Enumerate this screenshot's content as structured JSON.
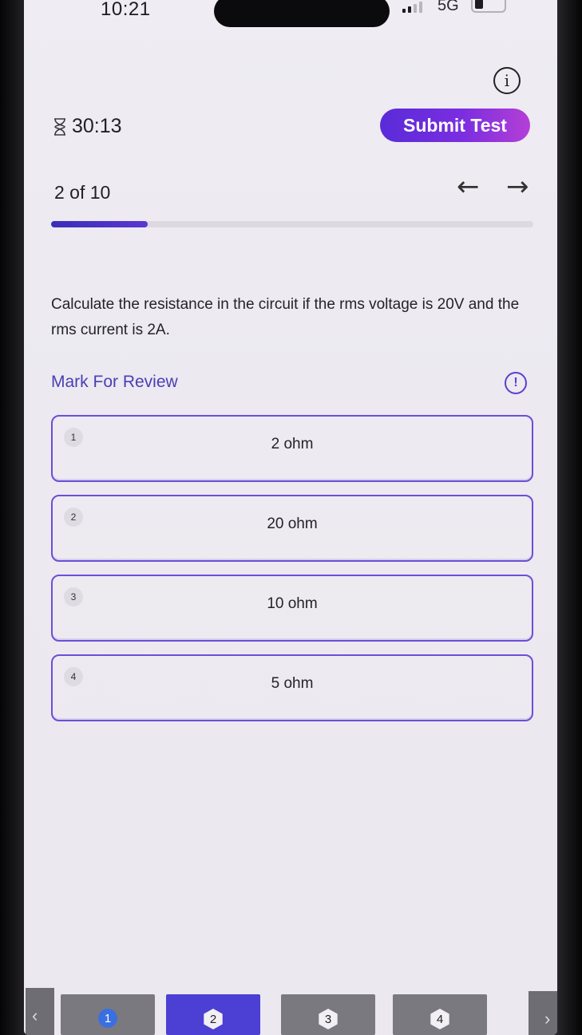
{
  "status_bar": {
    "time": "10:21",
    "network": "5G"
  },
  "header": {
    "timer": "30:13",
    "submit_label": "Submit Test",
    "info_icon": "info-icon"
  },
  "navigation": {
    "position_label": "2 of 10",
    "prev_icon": "arrow-left-icon",
    "next_icon": "arrow-right-icon",
    "progress_fraction": 0.2
  },
  "question": {
    "text": "Calculate the resistance in the circuit if the rms voltage is 20V and the rms current is 2A.",
    "review_label": "Mark For Review",
    "report_icon": "alert-icon"
  },
  "options": [
    {
      "number": "1",
      "text": "2 ohm"
    },
    {
      "number": "2",
      "text": "20 ohm"
    },
    {
      "number": "3",
      "text": "10 ohm"
    },
    {
      "number": "4",
      "text": "5 ohm"
    }
  ],
  "pager": {
    "pages": [
      {
        "label": "1",
        "state": "answered"
      },
      {
        "label": "2",
        "state": "current"
      },
      {
        "label": "3",
        "state": "unvisited"
      },
      {
        "label": "4",
        "state": "unvisited"
      }
    ]
  },
  "colors": {
    "accent": "#5a2bd8",
    "accent_end": "#b43fd6",
    "option_border": "#6b4fd6",
    "background": "#efecf3"
  }
}
